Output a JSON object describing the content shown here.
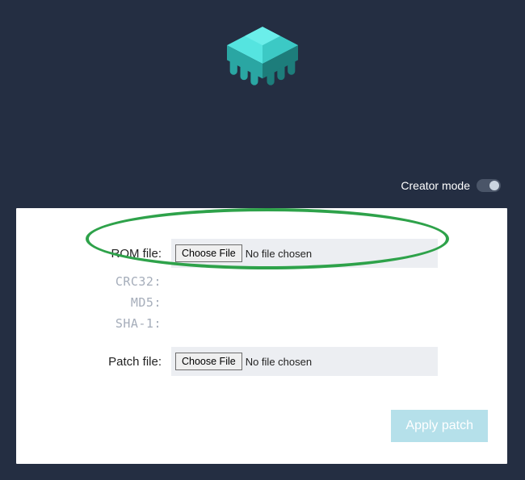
{
  "mode": {
    "label": "Creator mode",
    "enabled": false
  },
  "panel": {
    "rom": {
      "label": "ROM file:",
      "choose": "Choose File",
      "status": "No file chosen"
    },
    "hashes": {
      "crc32": "CRC32:",
      "md5": "MD5:",
      "sha1": "SHA-1:"
    },
    "patch": {
      "label": "Patch file:",
      "choose": "Choose File",
      "status": "No file chosen"
    },
    "apply": "Apply patch"
  },
  "colors": {
    "accent": "#3fd5d1",
    "highlight": "#2ea24a",
    "apply_bg": "#b5e0ea"
  }
}
